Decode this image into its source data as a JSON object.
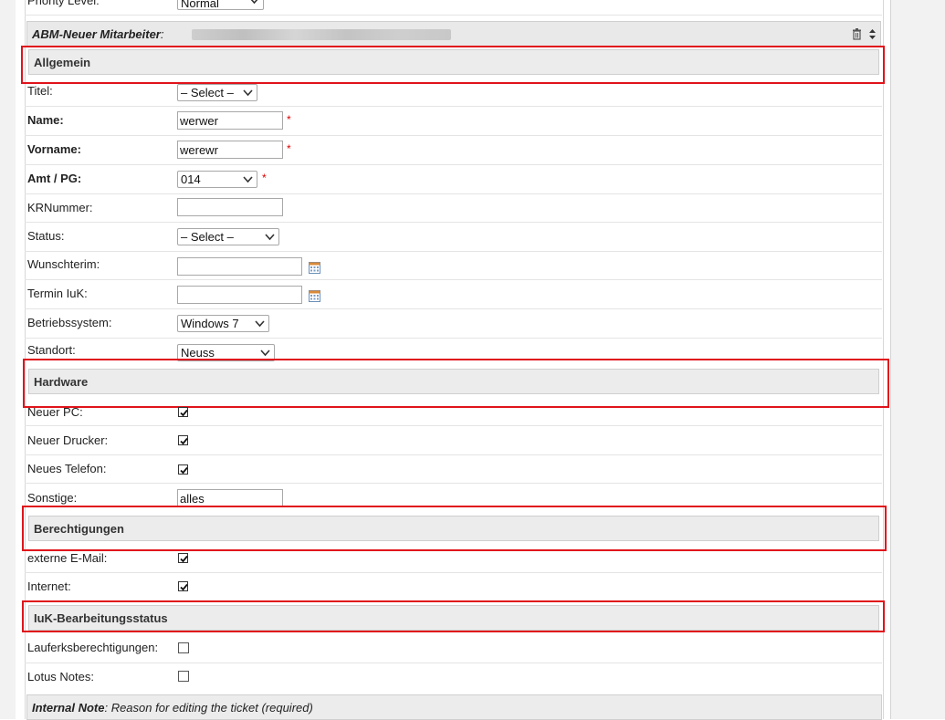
{
  "top": {
    "priority_label": "Priority Level:",
    "priority_value": "Normal",
    "ticket_prefix": "ABM-Neuer Mitarbeiter",
    "colon": ":"
  },
  "sections": {
    "allgemein": "Allgemein",
    "hardware": "Hardware",
    "berechtigungen": "Berechtigungen",
    "bearbeitungsstatus": "IuK-Bearbeitungsstatus"
  },
  "fields": {
    "titel": {
      "label": "Titel:",
      "value": "– Select –"
    },
    "name": {
      "label": "Name:",
      "value": "werwer",
      "required": "*"
    },
    "vorname": {
      "label": "Vorname:",
      "value": "werewr",
      "required": "*"
    },
    "amt": {
      "label": "Amt / PG:",
      "value": "014",
      "required": "*"
    },
    "krnummer": {
      "label": "KRNummer:",
      "value": ""
    },
    "status": {
      "label": "Status:",
      "value": "– Select –"
    },
    "wunschterim": {
      "label": "Wunschterim:",
      "value": ""
    },
    "termin_iuk": {
      "label": "Termin IuK:",
      "value": ""
    },
    "betriebssystem": {
      "label": "Betriebssystem:",
      "value": "Windows 7"
    },
    "standort": {
      "label": "Standort:",
      "value": "Neuss"
    },
    "neuer_pc": {
      "label": "Neuer PC:",
      "checked": true
    },
    "neuer_drucker": {
      "label": "Neuer Drucker:",
      "checked": true
    },
    "neues_telefon": {
      "label": "Neues Telefon:",
      "checked": true
    },
    "sonstige": {
      "label": "Sonstige:",
      "value": "alles"
    },
    "externe_email": {
      "label": "externe E-Mail:",
      "checked": true
    },
    "internet": {
      "label": "Internet:",
      "checked": true
    },
    "laufwerk": {
      "label": "Lauferksberechtigungen:",
      "checked": false
    },
    "lotus": {
      "label": "Lotus Notes:",
      "checked": false
    }
  },
  "internal_note": {
    "label": "Internal Note",
    "text": ": Reason for editing the ticket (required)"
  },
  "colors": {
    "highlight": "#e0131b",
    "section_bg": "#ececec",
    "required": "#dd0000"
  }
}
